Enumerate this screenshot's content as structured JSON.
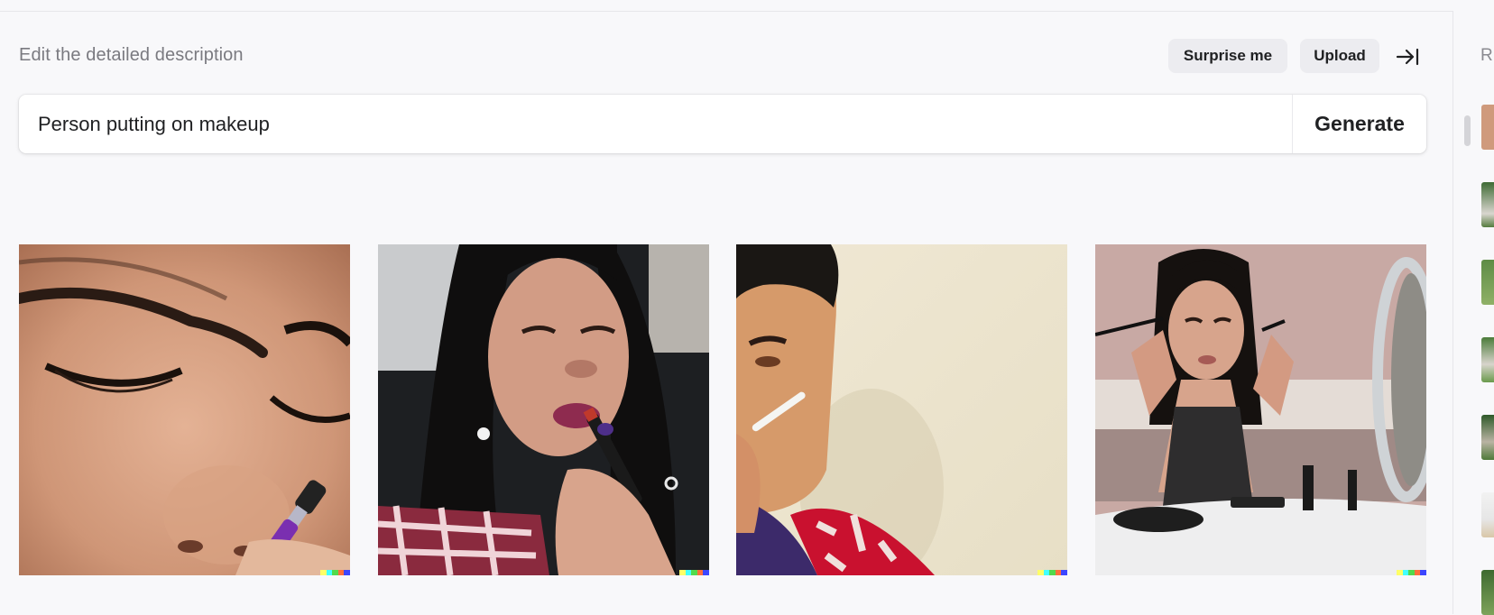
{
  "editor": {
    "heading": "Edit the detailed description",
    "surprise_label": "Surprise me",
    "upload_label": "Upload",
    "collapse_icon": "arrow-right-to-line-icon",
    "prompt_value": "Person putting on makeup",
    "generate_label": "Generate"
  },
  "results": [
    {
      "label": "Close-up of face with eyes closed and purple makeup brush on nose"
    },
    {
      "label": "Woman applying lipstick wearing red plaid shirt"
    },
    {
      "label": "Man with makeup applicator near face, light background"
    },
    {
      "label": "Woman applying eye makeup in front of a round mirror"
    }
  ],
  "history_panel": {
    "label_initial": "R",
    "thumbnail_count": 8
  },
  "colors": {
    "background": "#f8f8fa",
    "button_bg": "#ececf0",
    "text_primary": "#202123",
    "text_muted": "#7a7a80",
    "signature": [
      "#ffff66",
      "#42ffff",
      "#51da4c",
      "#ff6e3c",
      "#3c46ff"
    ]
  }
}
